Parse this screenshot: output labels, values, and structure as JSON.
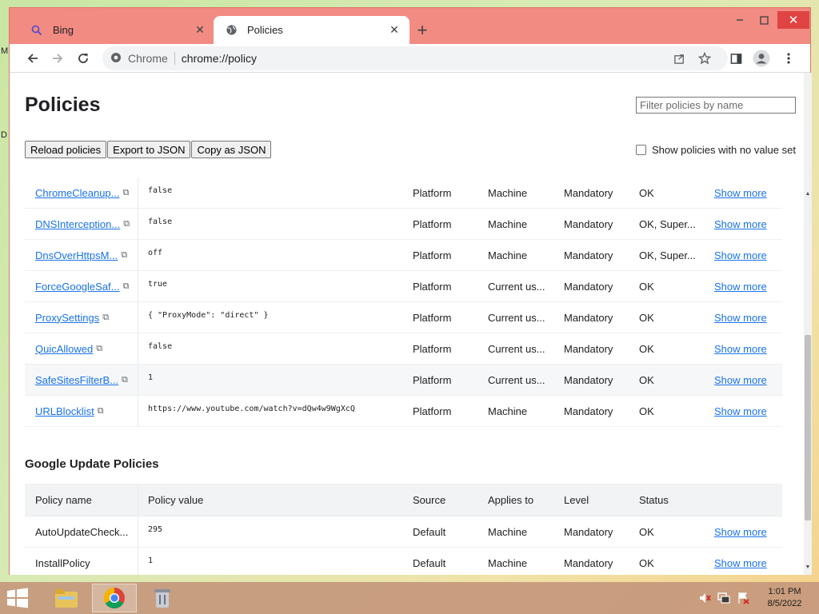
{
  "desktop": {
    "glyph_top": "M",
    "glyph_mid": "D"
  },
  "tabs": [
    {
      "label": "Bing",
      "icon": "search-icon",
      "active": false
    },
    {
      "label": "Policies",
      "icon": "globe-icon",
      "active": true
    }
  ],
  "toolbar": {
    "site": "Chrome",
    "url": "chrome://policy"
  },
  "page": {
    "title": "Policies",
    "filter_placeholder": "Filter policies by name",
    "buttons": {
      "reload": "Reload policies",
      "export": "Export to JSON",
      "copy": "Copy as JSON"
    },
    "show_no_value": "Show policies with no value set"
  },
  "chrome_policies": [
    {
      "name": "ChromeCleanup...",
      "value": "false",
      "source": "Platform",
      "applies": "Machine",
      "level": "Mandatory",
      "status": "OK",
      "more": "Show more"
    },
    {
      "name": "DNSInterception...",
      "value": "false",
      "source": "Platform",
      "applies": "Machine",
      "level": "Mandatory",
      "status": "OK, Super...",
      "more": "Show more"
    },
    {
      "name": "DnsOverHttpsM...",
      "value": "off",
      "source": "Platform",
      "applies": "Machine",
      "level": "Mandatory",
      "status": "OK, Super...",
      "more": "Show more"
    },
    {
      "name": "ForceGoogleSaf...",
      "value": "true",
      "source": "Platform",
      "applies": "Current us...",
      "level": "Mandatory",
      "status": "OK",
      "more": "Show more"
    },
    {
      "name": "ProxySettings",
      "value": "{ \"ProxyMode\": \"direct\" }",
      "source": "Platform",
      "applies": "Current us...",
      "level": "Mandatory",
      "status": "OK",
      "more": "Show more"
    },
    {
      "name": "QuicAllowed",
      "value": "false",
      "source": "Platform",
      "applies": "Current us...",
      "level": "Mandatory",
      "status": "OK",
      "more": "Show more"
    },
    {
      "name": "SafeSitesFilterB...",
      "value": "1",
      "source": "Platform",
      "applies": "Current us...",
      "level": "Mandatory",
      "status": "OK",
      "more": "Show more"
    },
    {
      "name": "URLBlocklist",
      "value": "https://www.youtube.com/watch?v=dQw4w9WgXcQ",
      "source": "Platform",
      "applies": "Machine",
      "level": "Mandatory",
      "status": "OK",
      "more": "Show more"
    }
  ],
  "google_update": {
    "title": "Google Update Policies",
    "headers": {
      "name": "Policy name",
      "value": "Policy value",
      "source": "Source",
      "applies": "Applies to",
      "level": "Level",
      "status": "Status"
    },
    "rows": [
      {
        "name": "AutoUpdateCheck...",
        "value": "295",
        "source": "Default",
        "applies": "Machine",
        "level": "Mandatory",
        "status": "OK",
        "more": "Show more"
      },
      {
        "name": "InstallPolicy",
        "value": "1",
        "source": "Default",
        "applies": "Machine",
        "level": "Mandatory",
        "status": "OK",
        "more": "Show more"
      }
    ]
  },
  "taskbar": {
    "time": "1:01 PM",
    "date": "8/5/2022"
  },
  "colors": {
    "frame": "#f28b82",
    "link": "#1a73e8",
    "close_button": "#e04343"
  }
}
